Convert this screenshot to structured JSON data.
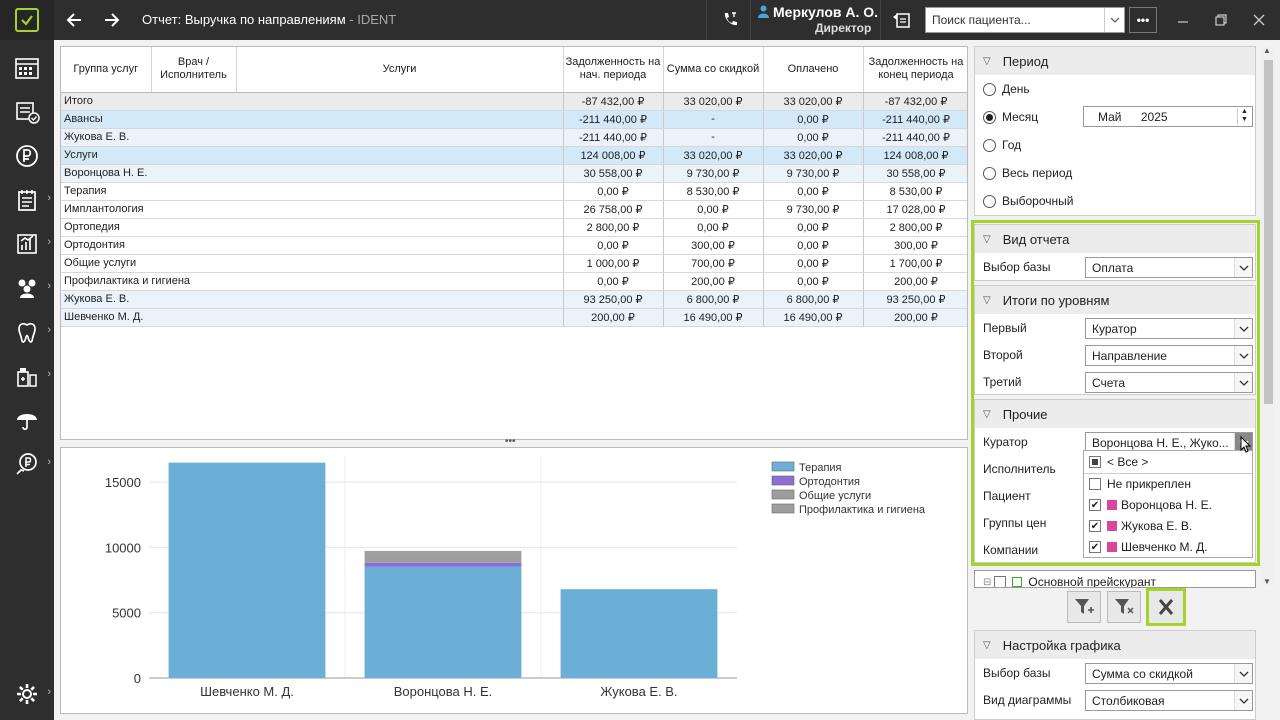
{
  "titlebar": {
    "title": "Отчет: Выручка по направлениям",
    "title_suffix": "- IDENT",
    "user_name": "Меркулов А. О.",
    "user_role": "Директор",
    "search_placeholder": "Поиск пациента..."
  },
  "table": {
    "headers": [
      "Группа услуг",
      "Врач / Исполнитель",
      "Услуги",
      "Задолженность на нач. периода",
      "Сумма со скидкой",
      "Оплачено",
      "Задолженность на конец периода"
    ],
    "rows": [
      {
        "level": 0,
        "name": "Итого",
        "debt_start": "-87 432,00 ₽",
        "sum_discount": "33 020,00 ₽",
        "paid": "33 020,00 ₽",
        "debt_end": "-87 432,00 ₽"
      },
      {
        "level": 1,
        "name": "Авансы",
        "debt_start": "-211 440,00 ₽",
        "sum_discount": "-",
        "paid": "0,00 ₽",
        "debt_end": "-211 440,00 ₽"
      },
      {
        "level": 2,
        "name": "Жукова Е. В.",
        "debt_start": "-211 440,00 ₽",
        "sum_discount": "-",
        "paid": "0,00 ₽",
        "debt_end": "-211 440,00 ₽"
      },
      {
        "level": 1,
        "name": "Услуги",
        "debt_start": "124 008,00 ₽",
        "sum_discount": "33 020,00 ₽",
        "paid": "33 020,00 ₽",
        "debt_end": "124 008,00 ₽"
      },
      {
        "level": 2,
        "name": "Воронцова Н. Е.",
        "debt_start": "30 558,00 ₽",
        "sum_discount": "9 730,00 ₽",
        "paid": "9 730,00 ₽",
        "debt_end": "30 558,00 ₽"
      },
      {
        "level": 3,
        "name": "Терапия",
        "debt_start": "0,00 ₽",
        "sum_discount": "8 530,00 ₽",
        "paid": "0,00 ₽",
        "debt_end": "8 530,00 ₽"
      },
      {
        "level": 3,
        "name": "Имплантология",
        "debt_start": "26 758,00 ₽",
        "sum_discount": "0,00 ₽",
        "paid": "9 730,00 ₽",
        "debt_end": "17 028,00 ₽"
      },
      {
        "level": 3,
        "name": "Ортопедия",
        "debt_start": "2 800,00 ₽",
        "sum_discount": "0,00 ₽",
        "paid": "0,00 ₽",
        "debt_end": "2 800,00 ₽"
      },
      {
        "level": 3,
        "name": "Ортодонтия",
        "debt_start": "0,00 ₽",
        "sum_discount": "300,00 ₽",
        "paid": "0,00 ₽",
        "debt_end": "300,00 ₽"
      },
      {
        "level": 3,
        "name": "Общие услуги",
        "debt_start": "1 000,00 ₽",
        "sum_discount": "700,00 ₽",
        "paid": "0,00 ₽",
        "debt_end": "1 700,00 ₽"
      },
      {
        "level": 3,
        "name": "Профилактика и гигиена",
        "debt_start": "0,00 ₽",
        "sum_discount": "200,00 ₽",
        "paid": "0,00 ₽",
        "debt_end": "200,00 ₽"
      },
      {
        "level": 2,
        "name": "Жукова Е. В.",
        "debt_start": "93 250,00 ₽",
        "sum_discount": "6 800,00 ₽",
        "paid": "6 800,00 ₽",
        "debt_end": "93 250,00 ₽"
      },
      {
        "level": 2,
        "name": "Шевченко М. Д.",
        "debt_start": "200,00 ₽",
        "sum_discount": "16 490,00 ₽",
        "paid": "16 490,00 ₽",
        "debt_end": "200,00 ₽"
      }
    ]
  },
  "chart_data": {
    "type": "bar",
    "stacked": true,
    "categories": [
      "Шевченко М. Д.",
      "Воронцова Н. Е.",
      "Жукова Е. В."
    ],
    "series": [
      {
        "name": "Терапия",
        "color": "#6baed6",
        "values": [
          16490,
          8530,
          6800
        ]
      },
      {
        "name": "Ортодонтия",
        "color": "#8b6fd6",
        "values": [
          0,
          300,
          0
        ]
      },
      {
        "name": "Общие услуги",
        "color": "#9e9e9e",
        "values": [
          0,
          700,
          0
        ]
      },
      {
        "name": "Профилактика и гигиена",
        "color": "#9e9e9e",
        "values": [
          0,
          200,
          0
        ]
      }
    ],
    "yticks": [
      "0",
      "5000",
      "10000",
      "15000"
    ],
    "ylim": [
      0,
      17000
    ],
    "legend": "top-right",
    "grid": true
  },
  "period": {
    "title": "Период",
    "options": [
      "День",
      "Месяц",
      "Год",
      "Весь период",
      "Выборочный"
    ],
    "selected": "Месяц",
    "month": "Май",
    "year": "2025"
  },
  "report_type": {
    "title": "Вид отчета",
    "base_label": "Выбор базы",
    "base_value": "Оплата"
  },
  "levels": {
    "title": "Итоги по уровням",
    "first_label": "Первый",
    "first_value": "Куратор",
    "second_label": "Второй",
    "second_value": "Направление",
    "third_label": "Третий",
    "third_value": "Счета"
  },
  "other": {
    "title": "Прочие",
    "curator_label": "Куратор",
    "curator_value": "Воронцова Н. Е., Жуко...",
    "executor_label": "Исполнитель",
    "patient_label": "Пациент",
    "price_groups_label": "Группы цен",
    "companies_label": "Компании",
    "pricelist_item": "Основной прейскурант"
  },
  "curator_dropdown": {
    "all": "< Все >",
    "items": [
      {
        "label": "Не прикреплен",
        "checked": false,
        "swatch": false
      },
      {
        "label": "Воронцова Н. Е.",
        "checked": true,
        "swatch": true
      },
      {
        "label": "Жукова Е. В.",
        "checked": true,
        "swatch": true
      },
      {
        "label": "Шевченко М. Д.",
        "checked": true,
        "swatch": true
      }
    ]
  },
  "chart_settings": {
    "title": "Настройка графика",
    "base_label": "Выбор базы",
    "base_value": "Сумма со скидкой",
    "type_label": "Вид диаграммы",
    "type_value": "Столбиковая"
  }
}
